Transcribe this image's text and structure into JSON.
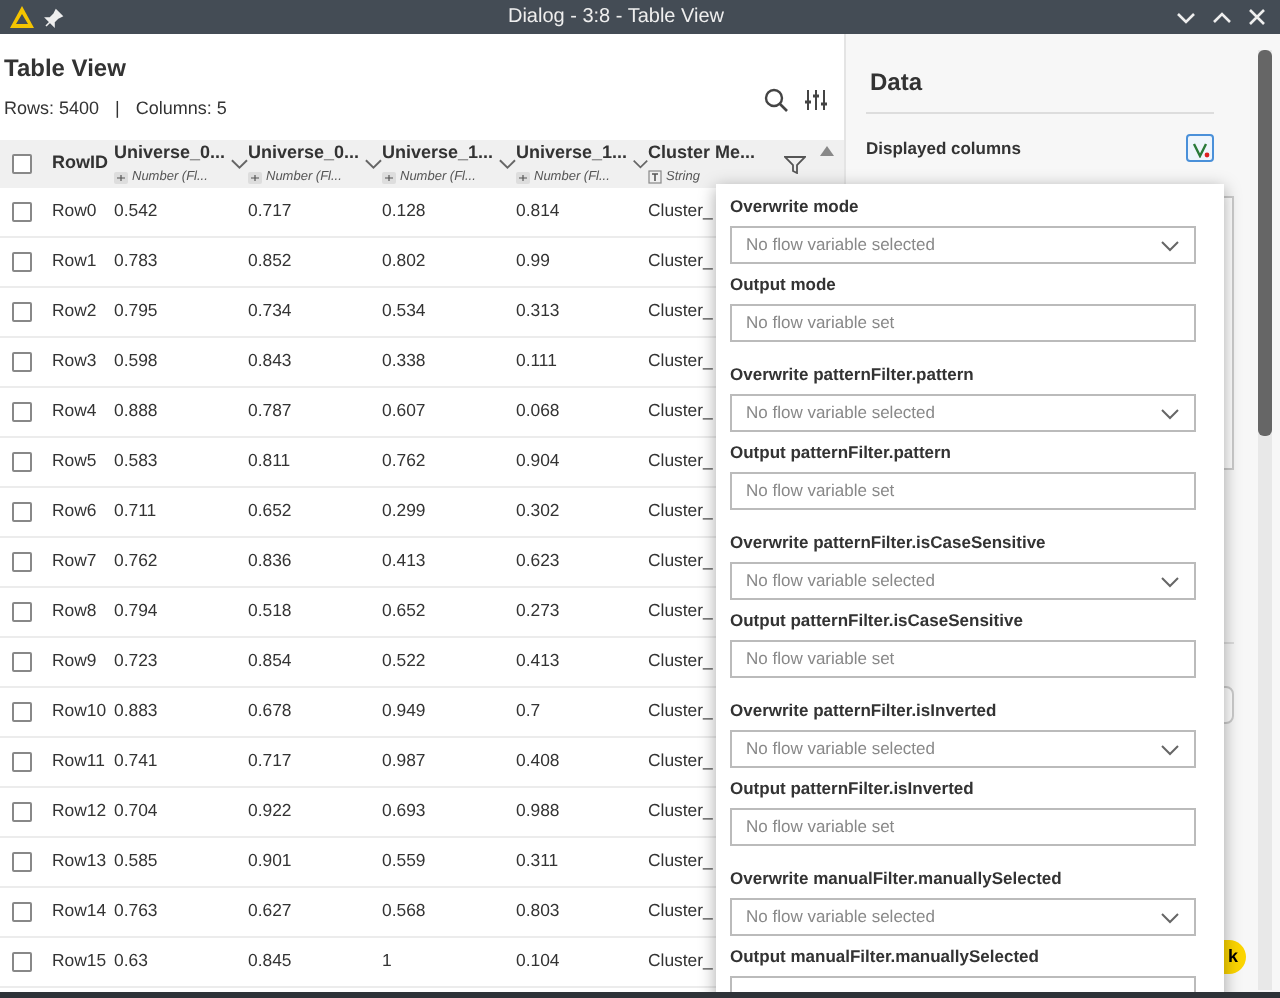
{
  "window": {
    "title": "Dialog - 3:8 - Table View"
  },
  "table_view": {
    "title": "Table View",
    "rows_count": "Rows: 5400",
    "separator": "|",
    "columns_count": "Columns: 5",
    "select_all": {
      "checked": false
    },
    "columns": [
      {
        "kind": "id",
        "name": "RowID"
      },
      {
        "kind": "number",
        "name": "Universe_0...",
        "type": "Number (Fl..."
      },
      {
        "kind": "number",
        "name": "Universe_0...",
        "type": "Number (Fl..."
      },
      {
        "kind": "number",
        "name": "Universe_1...",
        "type": "Number (Fl..."
      },
      {
        "kind": "number",
        "name": "Universe_1...",
        "type": "Number (Fl..."
      },
      {
        "kind": "string",
        "name": "Cluster Me...",
        "type": "String"
      }
    ],
    "rows": [
      {
        "checked": false,
        "cells": [
          "Row0",
          "0.542",
          "0.717",
          "0.128",
          "0.814",
          "Cluster_"
        ]
      },
      {
        "checked": false,
        "cells": [
          "Row1",
          "0.783",
          "0.852",
          "0.802",
          "0.99",
          "Cluster_"
        ]
      },
      {
        "checked": false,
        "cells": [
          "Row2",
          "0.795",
          "0.734",
          "0.534",
          "0.313",
          "Cluster_"
        ]
      },
      {
        "checked": false,
        "cells": [
          "Row3",
          "0.598",
          "0.843",
          "0.338",
          "0.111",
          "Cluster_"
        ]
      },
      {
        "checked": false,
        "cells": [
          "Row4",
          "0.888",
          "0.787",
          "0.607",
          "0.068",
          "Cluster_"
        ]
      },
      {
        "checked": false,
        "cells": [
          "Row5",
          "0.583",
          "0.811",
          "0.762",
          "0.904",
          "Cluster_"
        ]
      },
      {
        "checked": false,
        "cells": [
          "Row6",
          "0.711",
          "0.652",
          "0.299",
          "0.302",
          "Cluster_"
        ]
      },
      {
        "checked": false,
        "cells": [
          "Row7",
          "0.762",
          "0.836",
          "0.413",
          "0.623",
          "Cluster_"
        ]
      },
      {
        "checked": false,
        "cells": [
          "Row8",
          "0.794",
          "0.518",
          "0.652",
          "0.273",
          "Cluster_"
        ]
      },
      {
        "checked": false,
        "cells": [
          "Row9",
          "0.723",
          "0.854",
          "0.522",
          "0.413",
          "Cluster_"
        ]
      },
      {
        "checked": false,
        "cells": [
          "Row10",
          "0.883",
          "0.678",
          "0.949",
          "0.7",
          "Cluster_"
        ]
      },
      {
        "checked": false,
        "cells": [
          "Row11",
          "0.741",
          "0.717",
          "0.987",
          "0.408",
          "Cluster_"
        ]
      },
      {
        "checked": false,
        "cells": [
          "Row12",
          "0.704",
          "0.922",
          "0.693",
          "0.988",
          "Cluster_"
        ]
      },
      {
        "checked": false,
        "cells": [
          "Row13",
          "0.585",
          "0.901",
          "0.559",
          "0.311",
          "Cluster_"
        ]
      },
      {
        "checked": false,
        "cells": [
          "Row14",
          "0.763",
          "0.627",
          "0.568",
          "0.803",
          "Cluster_"
        ]
      },
      {
        "checked": false,
        "cells": [
          "Row15",
          "0.63",
          "0.845",
          "1",
          "0.104",
          "Cluster_"
        ]
      }
    ]
  },
  "settings_panel": {
    "title": "Data",
    "label": "Displayed columns",
    "ok_button": "k"
  },
  "flow_popup": {
    "fields": [
      {
        "kind": "select",
        "label": "Overwrite mode",
        "placeholder": "No flow variable selected"
      },
      {
        "kind": "input",
        "label": "Output mode",
        "placeholder": "No flow variable set"
      },
      {
        "kind": "select",
        "label": "Overwrite patternFilter.pattern",
        "placeholder": "No flow variable selected"
      },
      {
        "kind": "input",
        "label": "Output patternFilter.pattern",
        "placeholder": "No flow variable set"
      },
      {
        "kind": "select",
        "label": "Overwrite patternFilter.isCaseSensitive",
        "placeholder": "No flow variable selected"
      },
      {
        "kind": "input",
        "label": "Output patternFilter.isCaseSensitive",
        "placeholder": "No flow variable set"
      },
      {
        "kind": "select",
        "label": "Overwrite patternFilter.isInverted",
        "placeholder": "No flow variable selected"
      },
      {
        "kind": "input",
        "label": "Output patternFilter.isInverted",
        "placeholder": "No flow variable set"
      },
      {
        "kind": "select",
        "label": "Overwrite manualFilter.manuallySelected",
        "placeholder": "No flow variable selected"
      },
      {
        "kind": "input",
        "label": "Output manualFilter.manuallySelected"
      }
    ]
  }
}
